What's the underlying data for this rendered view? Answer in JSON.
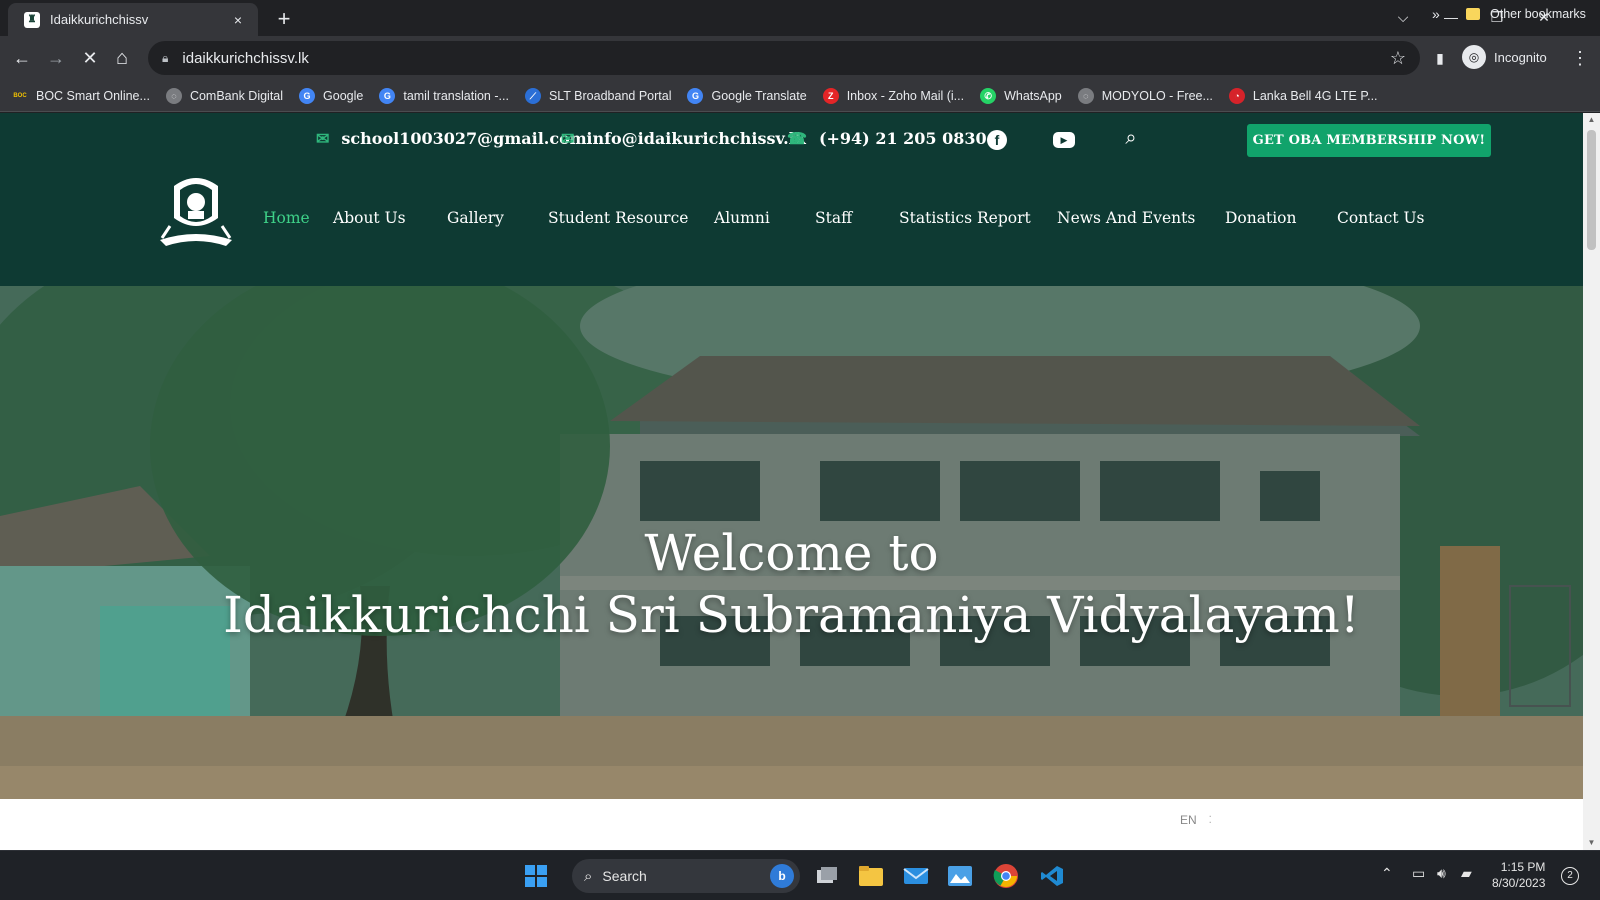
{
  "browser": {
    "tab": {
      "title": "Idaikkurichchissv",
      "close_icon": "×"
    },
    "new_tab_icon": "+",
    "window_controls": {
      "dropdown": "⌵",
      "minimize": "—",
      "restore": "❐",
      "close": "✕"
    },
    "toolbar": {
      "back": "←",
      "forward": "→",
      "stop": "✕",
      "home": "⌂",
      "url": "idaikkurichchissv.lk",
      "star": "☆",
      "profile_label": "Incognito",
      "menu": "⋮",
      "sidepanel": "▮"
    },
    "bookmarks": [
      {
        "label": "BOC Smart Online...",
        "icon": "BOC",
        "color": "#f2c200"
      },
      {
        "label": "ComBank Digital",
        "icon": "◌",
        "color": "#7a7c80"
      },
      {
        "label": "Google",
        "icon": "G",
        "color": "#4285f4"
      },
      {
        "label": "tamil translation -...",
        "icon": "G",
        "color": "#4285f4"
      },
      {
        "label": "SLT Broadband Portal",
        "icon": "⟋",
        "color": "#2b6fd6"
      },
      {
        "label": "Google Translate",
        "icon": "G",
        "color": "#4285f4"
      },
      {
        "label": "Inbox - Zoho Mail (i...",
        "icon": "Z",
        "color": "#e42527"
      },
      {
        "label": "WhatsApp",
        "icon": "✆",
        "color": "#25d366"
      },
      {
        "label": "MODYOLO - Free...",
        "icon": "◌",
        "color": "#7a7c80"
      },
      {
        "label": "Lanka Bell 4G LTE P...",
        "icon": "◔",
        "color": "#d6232a"
      }
    ],
    "bookmarks_more": "»",
    "other_bookmarks": "Other bookmarks"
  },
  "site": {
    "contacts": {
      "email1": "school1003027@gmail.com",
      "email2": "info@idaikurichchissv.lk",
      "phone": "(+94) 21 205 0830"
    },
    "social": {
      "facebook": "f",
      "youtube": "▶",
      "search": "⌕"
    },
    "cta_label": "GET OBA MEMBERSHIP NOW!",
    "nav": [
      "Home",
      "About Us",
      "Gallery",
      "Student Resource",
      "Alumni",
      "Staff",
      "Statistics Report",
      "News And Events",
      "Donation",
      "Contact Us"
    ],
    "hero": {
      "line1": "Welcome to",
      "line2": "Idaikkurichchi Sri Subramaniya Vidyalayam!"
    },
    "language": "EN"
  },
  "taskbar": {
    "search_label": "Search",
    "bing": "b",
    "clock_time": "1:15 PM",
    "clock_date": "8/30/2023",
    "notifications": "2",
    "tray_chevron": "⌃"
  },
  "colors": {
    "header_bg": "#0e3a33",
    "accent_green": "#11a36b",
    "active_nav": "#3ed188"
  }
}
